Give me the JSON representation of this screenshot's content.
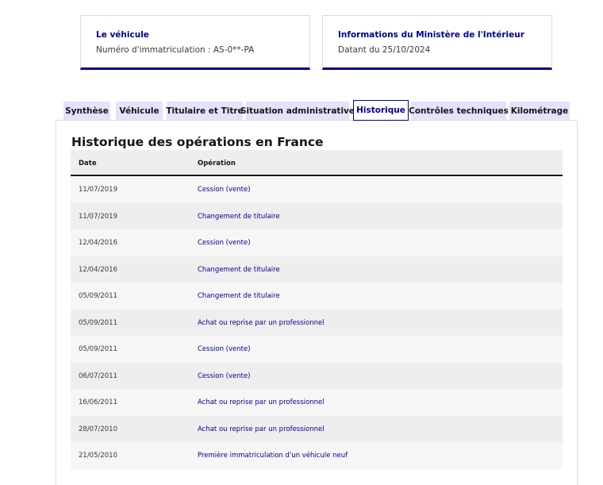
{
  "cards": {
    "vehicle": {
      "title": "Le véhicule",
      "subtitle": "Numéro d'immatriculation : AS-0**-PA"
    },
    "ministry": {
      "title": "Informations du Ministère de l'Intérieur",
      "subtitle": "Datant du 25/10/2024"
    }
  },
  "tabs": [
    {
      "label": "Synthèse"
    },
    {
      "label": "Véhicule"
    },
    {
      "label": "Titulaire et Titre"
    },
    {
      "label": "Situation administrative"
    },
    {
      "label": "Historique",
      "active": true
    },
    {
      "label": "Contrôles techniques"
    },
    {
      "label": "Kilométrage"
    }
  ],
  "main": {
    "title": "Historique des opérations en France",
    "table": {
      "headers": {
        "date": "Date",
        "operation": "Opération"
      },
      "rows": [
        {
          "date": "11/07/2019",
          "operation": "Cession (vente)"
        },
        {
          "date": "11/07/2019",
          "operation": "Changement de titulaire"
        },
        {
          "date": "12/04/2016",
          "operation": "Cession (vente)"
        },
        {
          "date": "12/04/2016",
          "operation": "Changement de titulaire"
        },
        {
          "date": "05/09/2011",
          "operation": "Changement de titulaire"
        },
        {
          "date": "05/09/2011",
          "operation": "Achat ou reprise par un professionnel"
        },
        {
          "date": "05/09/2011",
          "operation": "Cession (vente)"
        },
        {
          "date": "06/07/2011",
          "operation": "Cession (vente)"
        },
        {
          "date": "16/06/2011",
          "operation": "Achat ou reprise par un professionnel"
        },
        {
          "date": "28/07/2010",
          "operation": "Achat ou reprise par un professionnel"
        },
        {
          "date": "21/05/2010",
          "operation": "Première immatriculation d'un véhicule neuf"
        }
      ]
    }
  },
  "colors": {
    "accent": "#000091",
    "tab_bg": "#e3e3fd",
    "row_alt_bg": "#eeeeee"
  }
}
